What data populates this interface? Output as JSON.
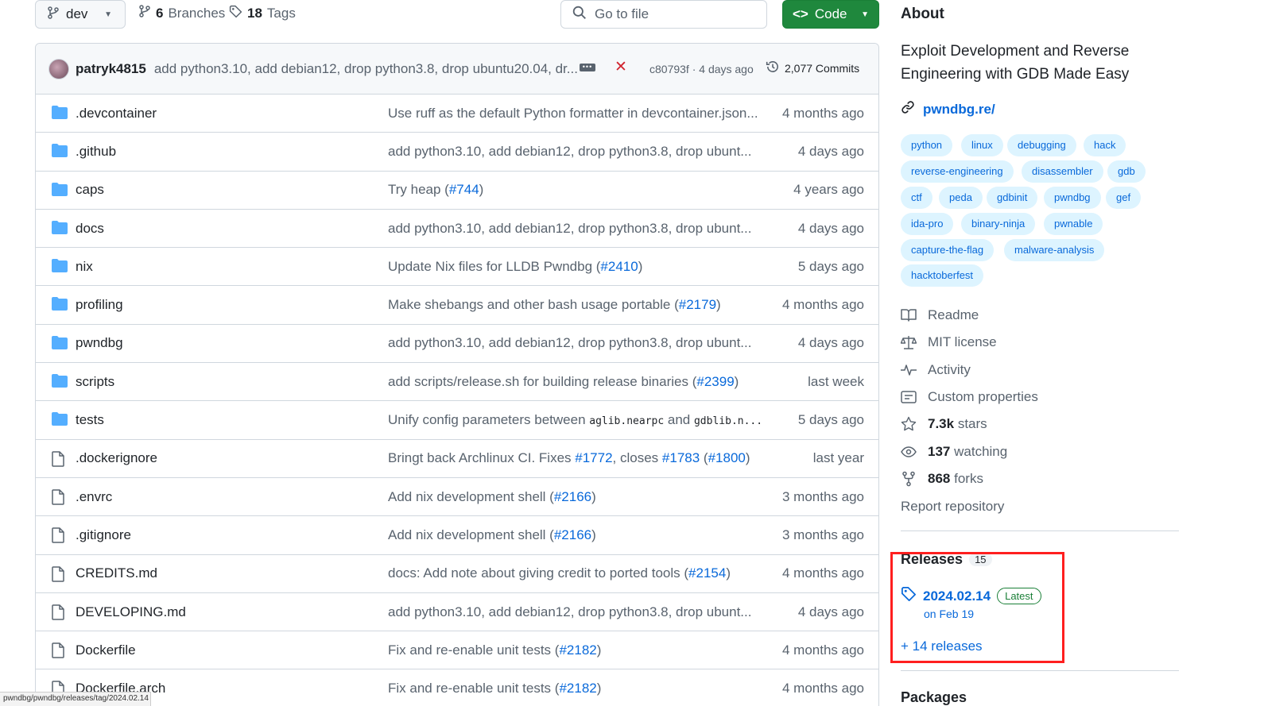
{
  "header": {
    "branch": "dev",
    "branches_count": "6",
    "branches_label": "Branches",
    "tags_count": "18",
    "tags_label": "Tags",
    "goto_placeholder": "Go to file",
    "code_label": "Code"
  },
  "commit": {
    "author": "patryk4815",
    "message": "add python3.10, add debian12, drop python3.8, drop ubuntu20.04, dr...",
    "sha_time": "c80793f · 4 days ago",
    "commits_count": "2,077 Commits",
    "status": "fail"
  },
  "files": [
    {
      "type": "dir",
      "name": ".devcontainer",
      "msg": "Use ruff as the default Python formatter in devcontainer.json...",
      "date": "4 months ago"
    },
    {
      "type": "dir",
      "name": ".github",
      "msg": "add python3.10, add debian12, drop python3.8, drop ubunt...",
      "date": "4 days ago"
    },
    {
      "type": "dir",
      "name": "caps",
      "msg": "Try heap (",
      "pr": "#744",
      "msg_end": ")",
      "date": "4 years ago"
    },
    {
      "type": "dir",
      "name": "docs",
      "msg": "add python3.10, add debian12, drop python3.8, drop ubunt...",
      "date": "4 days ago"
    },
    {
      "type": "dir",
      "name": "nix",
      "msg": "Update Nix files for LLDB Pwndbg (",
      "pr": "#2410",
      "msg_end": ")",
      "date": "5 days ago"
    },
    {
      "type": "dir",
      "name": "profiling",
      "msg": "Make shebangs and other bash usage portable (",
      "pr": "#2179",
      "msg_end": ")",
      "date": "4 months ago"
    },
    {
      "type": "dir",
      "name": "pwndbg",
      "msg": "add python3.10, add debian12, drop python3.8, drop ubunt...",
      "date": "4 days ago"
    },
    {
      "type": "dir",
      "name": "scripts",
      "msg": "add scripts/release.sh for building release binaries (",
      "pr": "#2399",
      "msg_end": ")",
      "date": "last week"
    },
    {
      "type": "dir",
      "name": "tests",
      "msg": "Unify config parameters between ",
      "code1": "aglib.nearpc",
      "mid": " and ",
      "code2": "gdblib.n...",
      "date": "5 days ago"
    },
    {
      "type": "file",
      "name": ".dockerignore",
      "msg": "Bringt back Archlinux CI. Fixes ",
      "pr": "#1772",
      "msg2": ", closes ",
      "pr2": "#1783",
      "msg3": " (",
      "pr3": "#1800",
      "msg_end": ")",
      "date": "last year"
    },
    {
      "type": "file",
      "name": ".envrc",
      "msg": "Add nix development shell (",
      "pr": "#2166",
      "msg_end": ")",
      "date": "3 months ago"
    },
    {
      "type": "file",
      "name": ".gitignore",
      "msg": "Add nix development shell (",
      "pr": "#2166",
      "msg_end": ")",
      "date": "3 months ago"
    },
    {
      "type": "file",
      "name": "CREDITS.md",
      "msg": "docs: Add note about giving credit to ported tools (",
      "pr": "#2154",
      "msg_end": ")",
      "date": "4 months ago"
    },
    {
      "type": "file",
      "name": "DEVELOPING.md",
      "msg": "add python3.10, add debian12, drop python3.8, drop ubunt...",
      "date": "4 days ago"
    },
    {
      "type": "file",
      "name": "Dockerfile",
      "msg": "Fix and re-enable unit tests (",
      "pr": "#2182",
      "msg_end": ")",
      "date": "4 months ago"
    },
    {
      "type": "file",
      "name": "Dockerfile.arch",
      "msg": "Fix and re-enable unit tests (",
      "pr": "#2182",
      "msg_end": ")",
      "date": "4 months ago"
    }
  ],
  "about": {
    "title": "About",
    "description": "Exploit Development and Reverse Engineering with GDB Made Easy",
    "homepage": "pwndbg.re/",
    "topics": [
      "python",
      "linux",
      "debugging",
      "hack",
      "reverse-engineering",
      "disassembler",
      "gdb",
      "ctf",
      "peda",
      "gdbinit",
      "pwndbg",
      "gef",
      "ida-pro",
      "binary-ninja",
      "pwnable",
      "capture-the-flag",
      "malware-analysis",
      "hacktoberfest"
    ],
    "readme": "Readme",
    "license": "MIT license",
    "activity": "Activity",
    "custom_props": "Custom properties",
    "stars_count": "7.3k",
    "stars_label": "stars",
    "watching_count": "137",
    "watching_label": "watching",
    "forks_count": "868",
    "forks_label": "forks",
    "report": "Report repository"
  },
  "releases": {
    "title": "Releases",
    "count": "15",
    "latest_tag": "2024.02.14",
    "latest_badge": "Latest",
    "latest_date": "on Feb 19",
    "more": "+ 14 releases"
  },
  "packages_title": "Packages",
  "statusbar": "pwndbg/pwndbg/releases/tag/2024.02.14",
  "colors": {
    "accent": "#0969da",
    "green": "#1f883d",
    "highlight": "#ff1f1f"
  }
}
